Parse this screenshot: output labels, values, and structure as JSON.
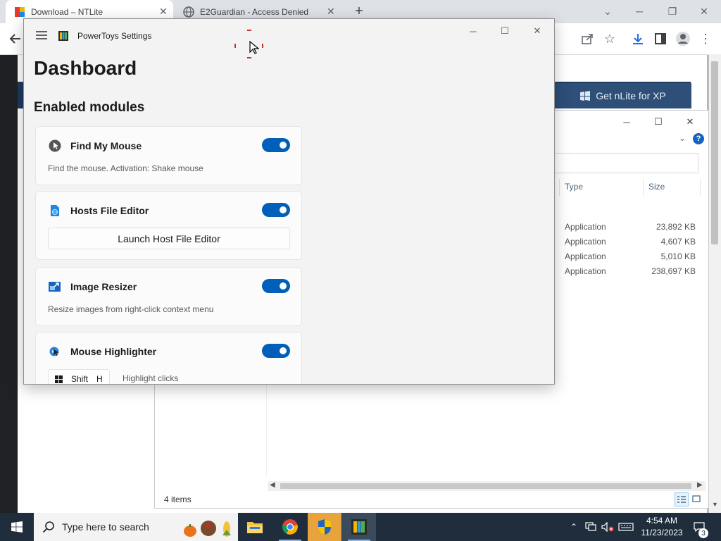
{
  "browser": {
    "tabs": [
      {
        "title": "Download – NTLite",
        "active": true
      },
      {
        "title": "E2Guardian - Access Denied",
        "active": false
      }
    ],
    "new_tab_symbol": "+",
    "toolbar_icons": [
      "back-icon",
      "share-icon",
      "star-icon",
      "download-icon",
      "sidebar-icon",
      "profile-icon",
      "menu-icon"
    ]
  },
  "website": {
    "nav_button_label": "Get nLite for XP"
  },
  "explorer": {
    "columns": [
      "Type",
      "Size"
    ],
    "files": [
      {
        "type": "Application",
        "size": "23,892 KB"
      },
      {
        "type": "Application",
        "size": "4,607 KB"
      },
      {
        "type": "Application",
        "size": "5,010 KB"
      },
      {
        "type": "Application",
        "size": "238,697 KB"
      }
    ],
    "status": "4 items"
  },
  "powertoys": {
    "window_title": "PowerToys Settings",
    "heading": "Dashboard",
    "section_title": "Enabled modules",
    "modules": [
      {
        "name": "Find My Mouse",
        "enabled": true,
        "description": "Find the mouse. Activation: Shake mouse"
      },
      {
        "name": "Hosts File Editor",
        "enabled": true,
        "button_label": "Launch Host File Editor"
      },
      {
        "name": "Image Resizer",
        "enabled": true,
        "description": "Resize images from right-click context menu"
      },
      {
        "name": "Mouse Highlighter",
        "enabled": true,
        "shortcut_keys": [
          "Shift",
          "H"
        ],
        "shortcut_label": "Highlight clicks"
      }
    ]
  },
  "taskbar": {
    "search_placeholder": "Type here to search",
    "time": "4:54 AM",
    "date": "11/23/2023",
    "notification_count": "3"
  },
  "colors": {
    "accent": "#005fb8",
    "taskbar": "#1f2d3d",
    "site_nav": "#1e3a5f"
  }
}
